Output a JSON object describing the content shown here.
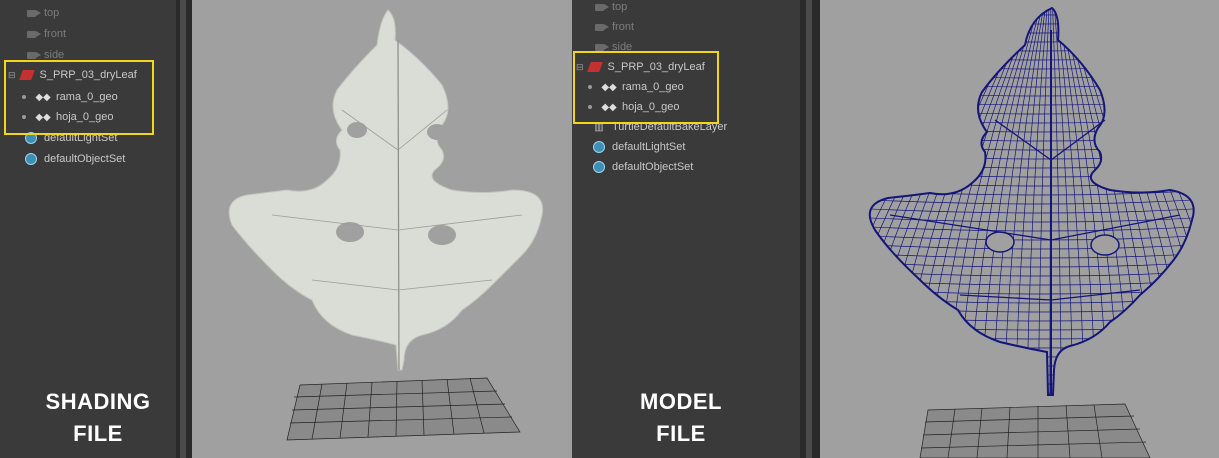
{
  "left": {
    "cameras": [
      "top",
      "front",
      "side"
    ],
    "group_label": "S_PRP_03_dryLeaf",
    "children": [
      "rama_0_geo",
      "hoja_0_geo"
    ],
    "sets": [
      "defaultLightSet",
      "defaultObjectSet"
    ],
    "caption_line1": "SHADING",
    "caption_line2": "FILE"
  },
  "right": {
    "cameras": [
      "top",
      "front",
      "side"
    ],
    "group_label": "S_PRP_03_dryLeaf",
    "children": [
      "rama_0_geo",
      "hoja_0_geo"
    ],
    "extra_item": "TurtleDefaultBakeLayer",
    "sets": [
      "defaultLightSet",
      "defaultObjectSet"
    ],
    "caption_line1": "MODEL",
    "caption_line2": "FILE"
  },
  "colors": {
    "highlight": "#f2d61a",
    "shaded_leaf": "#d9ddd6",
    "wire_leaf": "#15157a",
    "viewport_bg": "#a0a0a0",
    "outliner_bg": "#3a3a3a"
  },
  "icons": [
    "camera-icon",
    "group-icon",
    "mesh-icon",
    "set-icon",
    "bake-layer-icon"
  ]
}
